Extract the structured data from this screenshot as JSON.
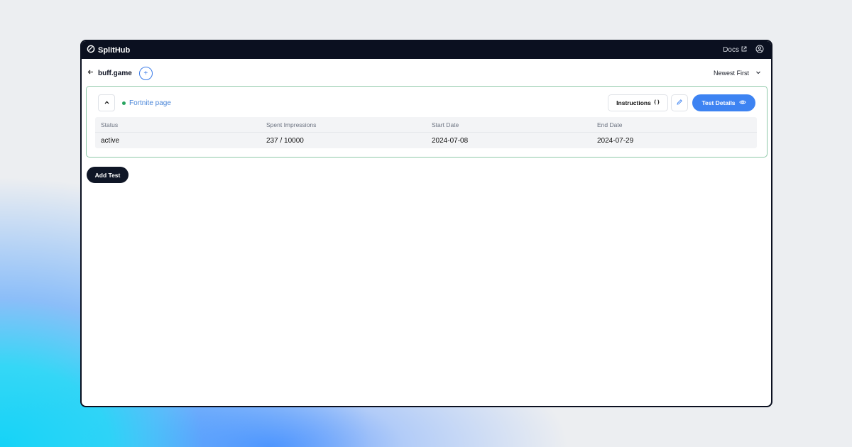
{
  "app": {
    "brand": "SplitHub",
    "docs_label": "Docs"
  },
  "project": {
    "name": "buff.game"
  },
  "sort": {
    "selected": "Newest First"
  },
  "test": {
    "name": "Fortnite page",
    "status_color": "#27a45f",
    "instructions_label": "Instructions",
    "details_label": "Test Details",
    "columns": [
      "Status",
      "Spent Impressions",
      "Start Date",
      "End Date"
    ],
    "values": [
      "active",
      "237 / 10000",
      "2024-07-08",
      "2024-07-29"
    ]
  },
  "actions": {
    "add_test_label": "Add Test"
  },
  "colors": {
    "primary": "#3d83f2",
    "dark": "#0b1020",
    "card_border": "#8fc9a9"
  }
}
